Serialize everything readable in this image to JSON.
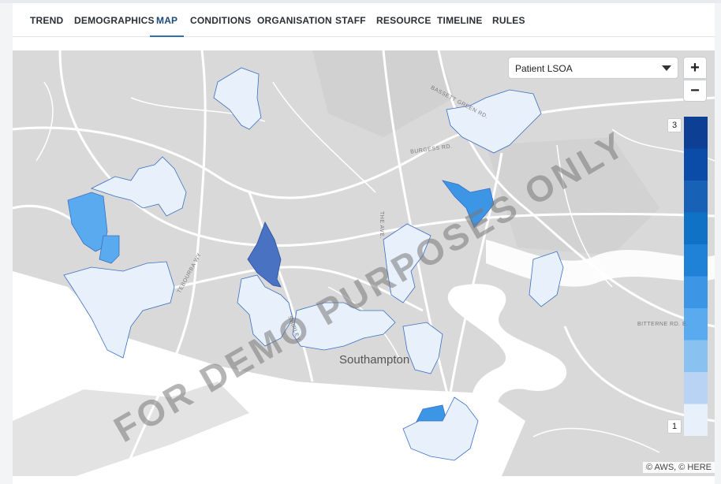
{
  "tabs": [
    {
      "label": "TREND"
    },
    {
      "label": "DEMOGRAPHICS"
    },
    {
      "label": "MAP",
      "active": true
    },
    {
      "label": "CONDITIONS"
    },
    {
      "label": "ORGANISATION"
    },
    {
      "label": "STAFF"
    },
    {
      "label": "RESOURCE"
    },
    {
      "label": "TIMELINE"
    },
    {
      "label": "RULES"
    }
  ],
  "map": {
    "layer_select": {
      "selected": "Patient LSOA"
    },
    "zoom_in": "+",
    "zoom_out": "−",
    "legend": {
      "max_label": "3",
      "min_label": "1",
      "colors": [
        "#0d3f95",
        "#0b4ca8",
        "#1762b6",
        "#0f72c4",
        "#1f82d6",
        "#3d95e6",
        "#5aaaf0",
        "#89c1f1",
        "#b8d3f3",
        "#e8f1fb"
      ]
    },
    "city_label": "Southampton",
    "road_labels": {
      "bassett": "BASSETT GREEN RD.",
      "burgess": "BURGESS RD.",
      "theave": "THE AVE.",
      "tebourba": "TEBOURBA WY",
      "bitterne": "BITTERNE RD. E.",
      "shirley": "SHIRLEY"
    },
    "watermark": "FOR DEMO PURPOSES ONLY",
    "attribution": "© AWS, © HERE"
  }
}
